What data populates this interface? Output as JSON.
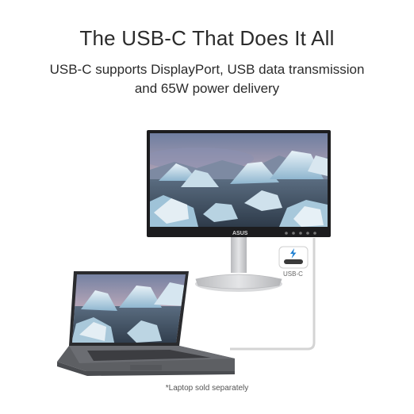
{
  "headline": "The USB-C That Does It All",
  "subline": {
    "line1": "USB-C supports DisplayPort, USB data transmission",
    "line2": "and 65W power delivery"
  },
  "monitor": {
    "brand": "ASUS",
    "port_label": "USB-C",
    "port_icon": "thunderbolt-icon"
  },
  "footnote": "*Laptop sold separately",
  "colors": {
    "bezel": "#1c1c1e",
    "stand": "#c9cacd",
    "cable": "#d9d9d9",
    "laptop_body": "#5d5f63"
  }
}
